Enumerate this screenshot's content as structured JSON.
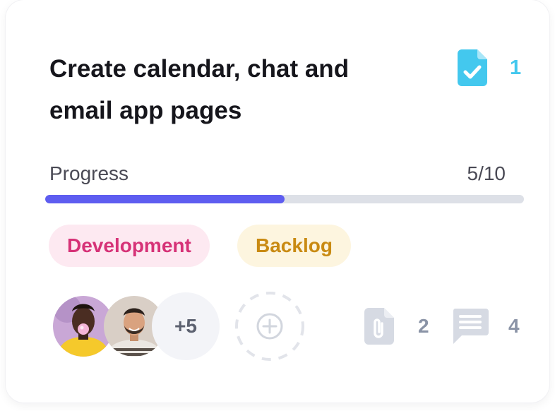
{
  "card": {
    "title": "Create calendar, chat and email app pages",
    "task_icon": "task-document-check-icon",
    "task_count": "1",
    "progress": {
      "label": "Progress",
      "value_text": "5/10",
      "completed": 5,
      "total": 10
    },
    "tags": [
      {
        "label": "Development",
        "color": "#d63277",
        "background": "#fde9f1"
      },
      {
        "label": "Backlog",
        "color": "#c98a12",
        "background": "#fdf5df"
      }
    ],
    "members": {
      "avatars": [
        "avatar-woman",
        "avatar-man"
      ],
      "more_label": "+5",
      "add_icon": "add-member-icon"
    },
    "attachments": {
      "icon": "paperclip-document-icon",
      "count": "2"
    },
    "comments": {
      "icon": "comment-icon",
      "count": "4"
    }
  },
  "colors": {
    "accent": "#5e5df0",
    "task_icon": "#43c8ee",
    "muted": "#8a93a6",
    "track": "#dde0e7"
  }
}
